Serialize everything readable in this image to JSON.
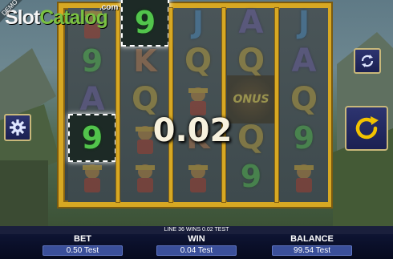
{
  "watermark": {
    "part1": "Slot",
    "part2": "Catalog",
    "suffix": ".com",
    "demo": "DEMO"
  },
  "reels": [
    [
      "pic",
      "9",
      "A",
      "9",
      "pic"
    ],
    [
      "9",
      "K",
      "Q",
      "pic",
      "pic"
    ],
    [
      "J",
      "Q",
      "pic",
      "K",
      "pic"
    ],
    [
      "A",
      "Q",
      "bonus",
      "Q",
      "9"
    ],
    [
      "J",
      "A",
      "Q",
      "9",
      "pic"
    ]
  ],
  "win_overlay": "0.02",
  "symbols": {
    "pic_icon": "warrior-icon",
    "bonus_label": "ONUS"
  },
  "status_line": "LINE 36 WINS 0.02 TEST",
  "footer": {
    "bet_label": "BET",
    "bet_value": "0.50 Test",
    "win_label": "WIN",
    "win_value": "0.04 Test",
    "balance_label": "BALANCE",
    "balance_value": "99.54 Test"
  },
  "colors": {
    "frame": "#d7a823",
    "panel": "#0e1433",
    "value_box": "#3a4f9a"
  }
}
